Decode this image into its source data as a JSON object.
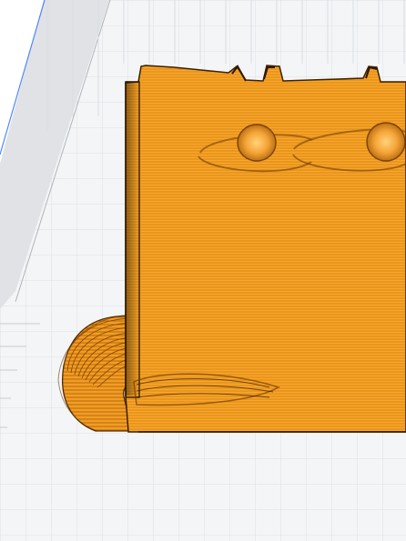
{
  "viewport": {
    "kind": "3d-slicer-layer-preview",
    "background_color": "#ffffff",
    "build_plate": {
      "fill_color": "#f4f5f7",
      "grid_color": "#dde1e6",
      "edge_fill_color": "#c9cdd2",
      "edge_line_color": "#4f86ff"
    },
    "model": {
      "object": "printed-part-with-two-holes-and-brim",
      "fill_color": "#f9a628",
      "layer_line_color": "#b86708",
      "shadow_color": "#231300",
      "visible_holes": 2,
      "visible_top_notches": 4
    }
  }
}
